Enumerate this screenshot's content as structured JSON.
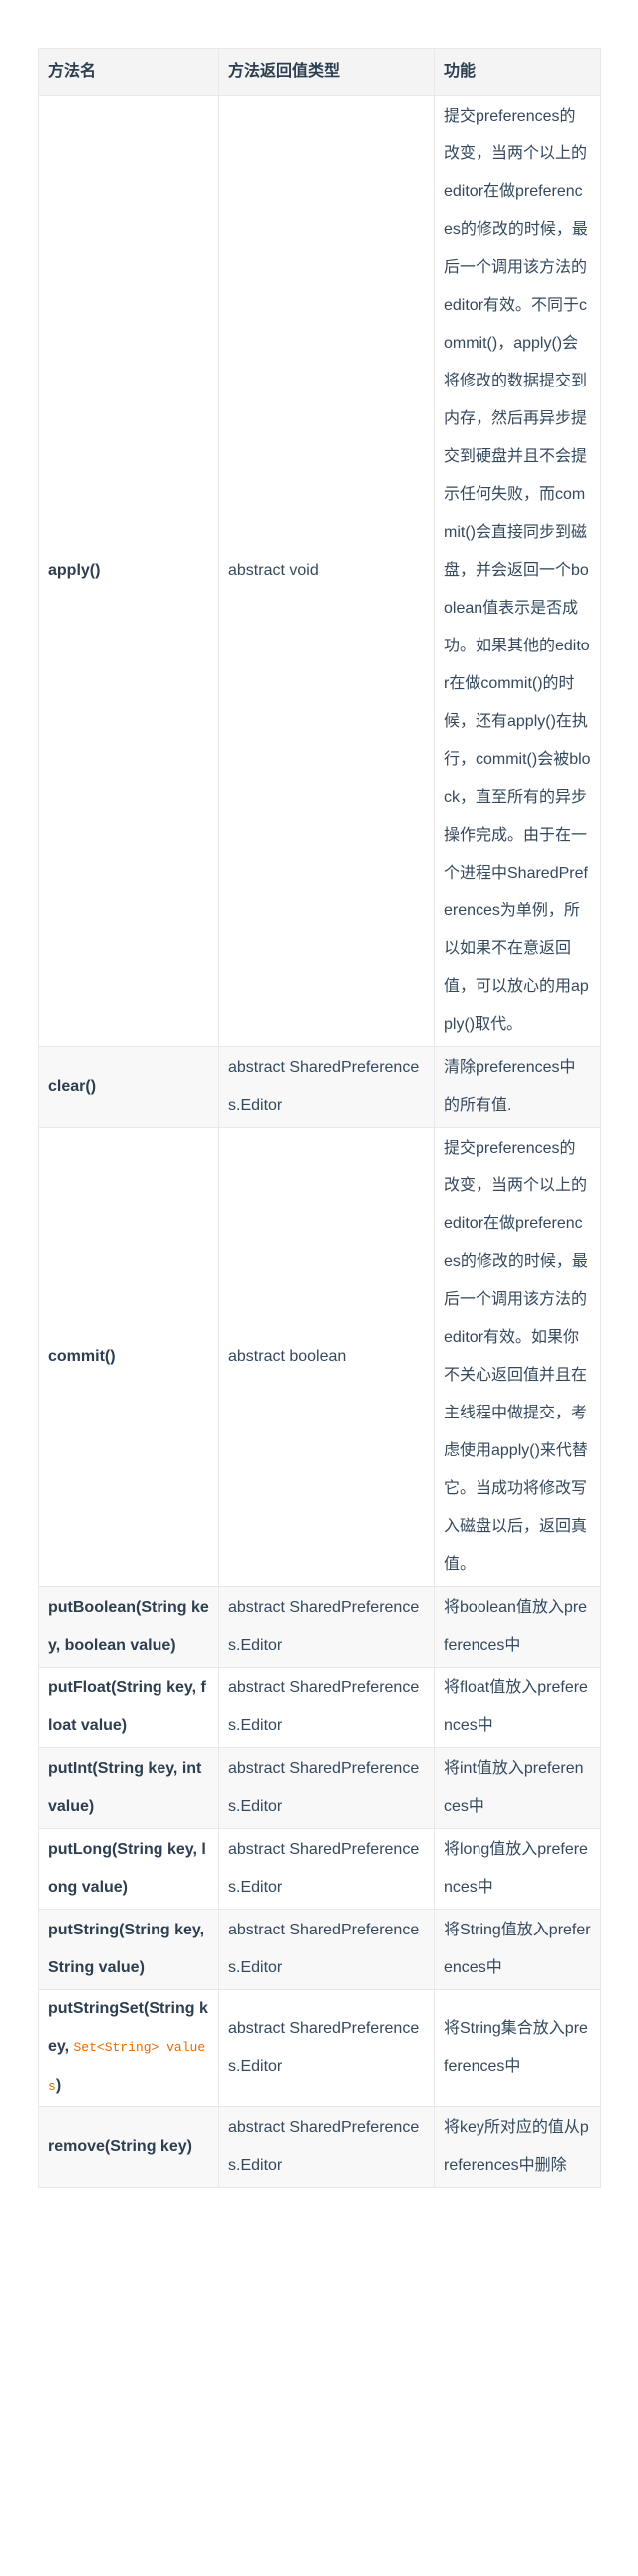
{
  "table": {
    "headers": [
      "方法名",
      "方法返回值类型",
      "功能"
    ],
    "rows": [
      {
        "name": "apply()",
        "type": "abstract void",
        "desc": "提交preferences的改变，当两个以上的editor在做preferences的修改的时候，最后一个调用该方法的editor有效。不同于commit()，apply()会将修改的数据提交到内存，然后再异步提交到硬盘并且不会提示任何失败，而commit()会直接同步到磁盘，并会返回一个boolean值表示是否成功。如果其他的editor在做commit()的时候，还有apply()在执行，commit()会被block，直至所有的异步操作完成。由于在一个进程中SharedPreferences为单例，所以如果不在意返回值，可以放心的用apply()取代。"
      },
      {
        "name": "clear()",
        "type": "abstract SharedPreferences.Editor",
        "desc": "清除preferences中的所有值."
      },
      {
        "name": "commit()",
        "type": "abstract boolean",
        "desc": "提交preferences的改变，当两个以上的editor在做preferences的修改的时候，最后一个调用该方法的editor有效。如果你不关心返回值并且在主线程中做提交，考虑使用apply()来代替它。当成功将修改写入磁盘以后，返回真值。"
      },
      {
        "name": "putBoolean(String key, boolean value)",
        "type": "abstract SharedPreferences.Editor",
        "desc": "将boolean值放入preferences中"
      },
      {
        "name": "putFloat(String key, float value)",
        "type": "abstract SharedPreferences.Editor",
        "desc": "将float值放入preferences中"
      },
      {
        "name": "putInt(String key, int value)",
        "type": "abstract SharedPreferences.Editor",
        "desc": "将int值放入preferences中"
      },
      {
        "name": "putLong(String key, long value)",
        "type": "abstract SharedPreferences.Editor",
        "desc": "将long值放入preferences中"
      },
      {
        "name": "putString(String key, String value)",
        "type": "abstract SharedPreferences.Editor",
        "desc": "将String值放入preferences中"
      },
      {
        "name_prefix": "putStringSet(String key, ",
        "name_code": "Set<String> values",
        "name_suffix": ")",
        "type": "abstract SharedPreferences.Editor",
        "desc": "将String集合放入preferences中"
      },
      {
        "name": "remove(String key)",
        "type": "abstract SharedPreferences.Editor",
        "desc": "将key所对应的值从preferences中删除"
      }
    ]
  },
  "colors": {
    "text": "#34495e",
    "header_bg": "#f4f4f4",
    "stripe_bg": "#f8f8f8",
    "border": "#e8e8e8",
    "code": "#e96900"
  }
}
